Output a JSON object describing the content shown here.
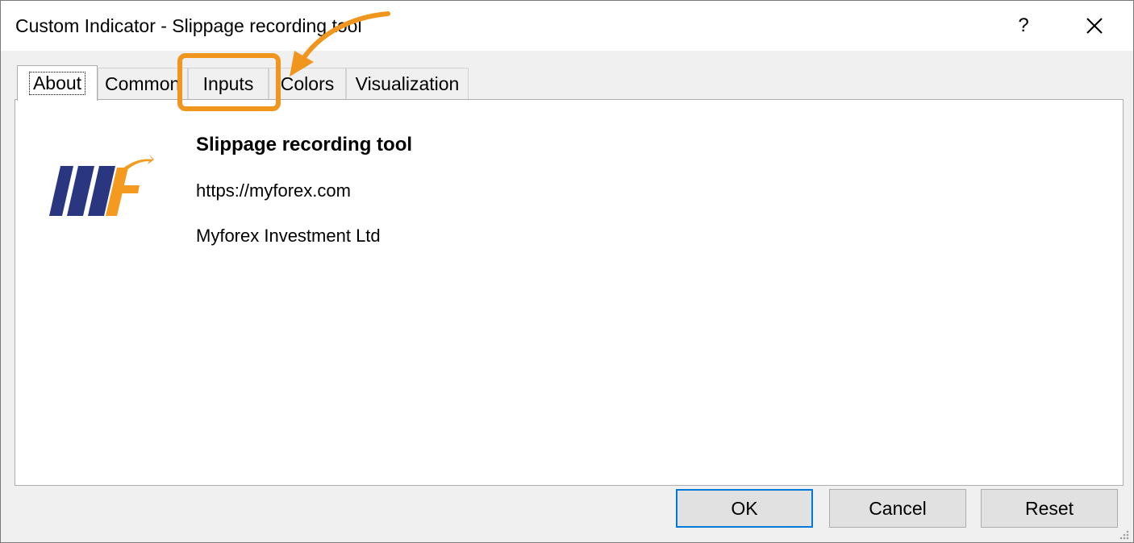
{
  "window": {
    "title": "Custom Indicator - Slippage recording tool",
    "help_label": "?",
    "close_icon": "close-icon"
  },
  "tabs": [
    {
      "label": "About",
      "active": true
    },
    {
      "label": "Common",
      "active": false
    },
    {
      "label": "Inputs",
      "active": false
    },
    {
      "label": "Colors",
      "active": false
    },
    {
      "label": "Visualization",
      "active": false
    }
  ],
  "about": {
    "logo": "myforex-logo",
    "title": "Slippage recording tool",
    "url": "https://myforex.com",
    "company": "Myforex Investment Ltd"
  },
  "buttons": {
    "ok_label": "OK",
    "cancel_label": "Cancel",
    "reset_label": "Reset"
  },
  "annotation": {
    "highlight_color": "#f0961e",
    "highlight_target": "Inputs"
  },
  "colors": {
    "accent": "#0078d7",
    "logo_blue": "#2a3780",
    "logo_orange": "#f39a1f"
  }
}
